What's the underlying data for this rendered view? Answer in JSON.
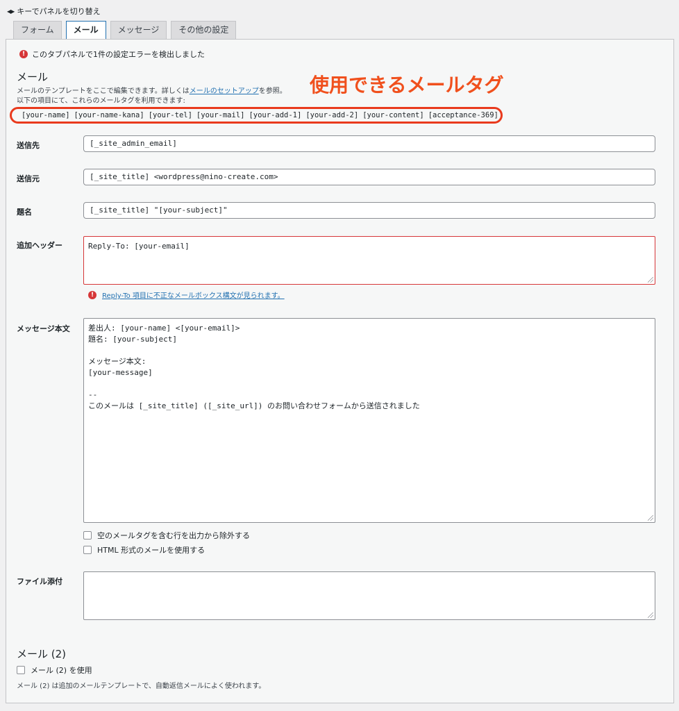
{
  "panel_switch_hint": "キーでパネルを切り替え",
  "tabs": [
    {
      "label": "フォーム",
      "active": false
    },
    {
      "label": "メール",
      "active": true
    },
    {
      "label": "メッセージ",
      "active": false
    },
    {
      "label": "その他の設定",
      "active": false
    }
  ],
  "panel_error": "このタブパネルで1件の設定エラーを検出しました",
  "section": {
    "title": "メール",
    "desc_prefix": "メールのテンプレートをここで編集できます。詳しくは",
    "desc_link": "メールのセットアップ",
    "desc_suffix": "を参照。",
    "desc_line2": "以下の項目にて、これらのメールタグを利用できます:"
  },
  "mail_tags": [
    "[your-name]",
    "[your-name-kana]",
    "[your-tel]",
    "[your-mail]",
    "[your-add-1]",
    "[your-add-2]",
    "[your-content]",
    "[acceptance-369]"
  ],
  "annotation": "使用できるメールタグ",
  "fields": {
    "to": {
      "label": "送信先",
      "value": "[_site_admin_email]"
    },
    "from": {
      "label": "送信元",
      "value": "[_site_title] <wordpress@nino-create.com>"
    },
    "subject": {
      "label": "題名",
      "value": "[_site_title] \"[your-subject]\""
    },
    "headers": {
      "label": "追加ヘッダー",
      "value": "Reply-To: [your-email]",
      "error_link": "Reply-To 項目に不正なメールボックス構文が見られます。"
    },
    "body": {
      "label": "メッセージ本文",
      "value": "差出人: [your-name] <[your-email]>\n題名: [your-subject]\n\nメッセージ本文:\n[your-message]\n\n-- \nこのメールは [_site_title] ([_site_url]) のお問い合わせフォームから送信されました"
    },
    "attachments": {
      "label": "ファイル添付",
      "value": ""
    }
  },
  "options": {
    "exclude_blank": "空のメールタグを含む行を出力から除外する",
    "use_html": "HTML 形式のメールを使用する"
  },
  "mail2": {
    "title": "メール (2)",
    "checkbox": "メール (2) を使用",
    "note": "メール (2) は追加のメールテンプレートで、自動返信メールによく使われます。"
  },
  "colors": {
    "error": "#d63638",
    "link": "#2271b1",
    "annotation": "#f0501d"
  }
}
